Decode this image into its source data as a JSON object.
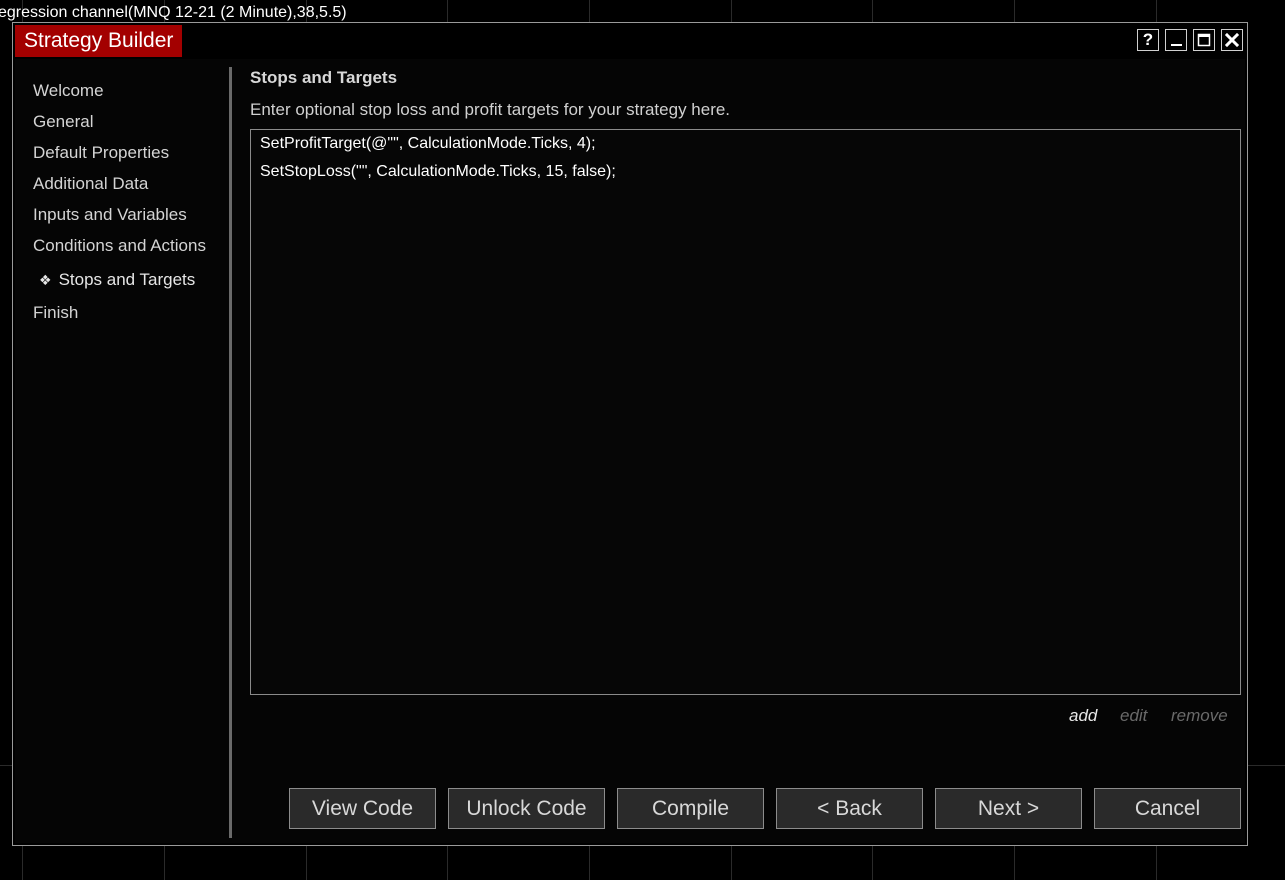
{
  "chart": {
    "indicator_label": "egression channel(MNQ 12-21 (2 Minute),38,5.5)"
  },
  "window": {
    "title": "Strategy Builder",
    "controls": {
      "help": "?",
      "help_icon": "question-icon",
      "minimize_icon": "minimize-icon",
      "maximize_icon": "maximize-icon",
      "close_icon": "close-icon"
    }
  },
  "sidebar": {
    "items": [
      {
        "label": "Welcome"
      },
      {
        "label": "General"
      },
      {
        "label": "Default Properties"
      },
      {
        "label": "Additional Data"
      },
      {
        "label": "Inputs and Variables"
      },
      {
        "label": "Conditions and Actions"
      },
      {
        "label": "Stops and Targets",
        "active": true,
        "bullet": "❖"
      },
      {
        "label": "Finish"
      }
    ]
  },
  "main": {
    "title": "Stops and Targets",
    "description": "Enter optional stop loss and profit targets for your strategy here.",
    "code_lines": [
      "SetProfitTarget(@\"\", CalculationMode.Ticks, 4);",
      "SetStopLoss(\"\", CalculationMode.Ticks, 15, false);"
    ],
    "actions": {
      "add": "add",
      "edit": "edit",
      "remove": "remove"
    }
  },
  "footer": {
    "view_code": "View Code",
    "unlock_code": "Unlock Code",
    "compile": "Compile",
    "back": "< Back",
    "next": "Next >",
    "cancel": "Cancel"
  },
  "colors": {
    "accent_title": "#a30000",
    "background": "#000000",
    "grid": "#2a2a2a",
    "button_bg": "#2a2a2a",
    "disabled_link": "#6a6a6a"
  }
}
